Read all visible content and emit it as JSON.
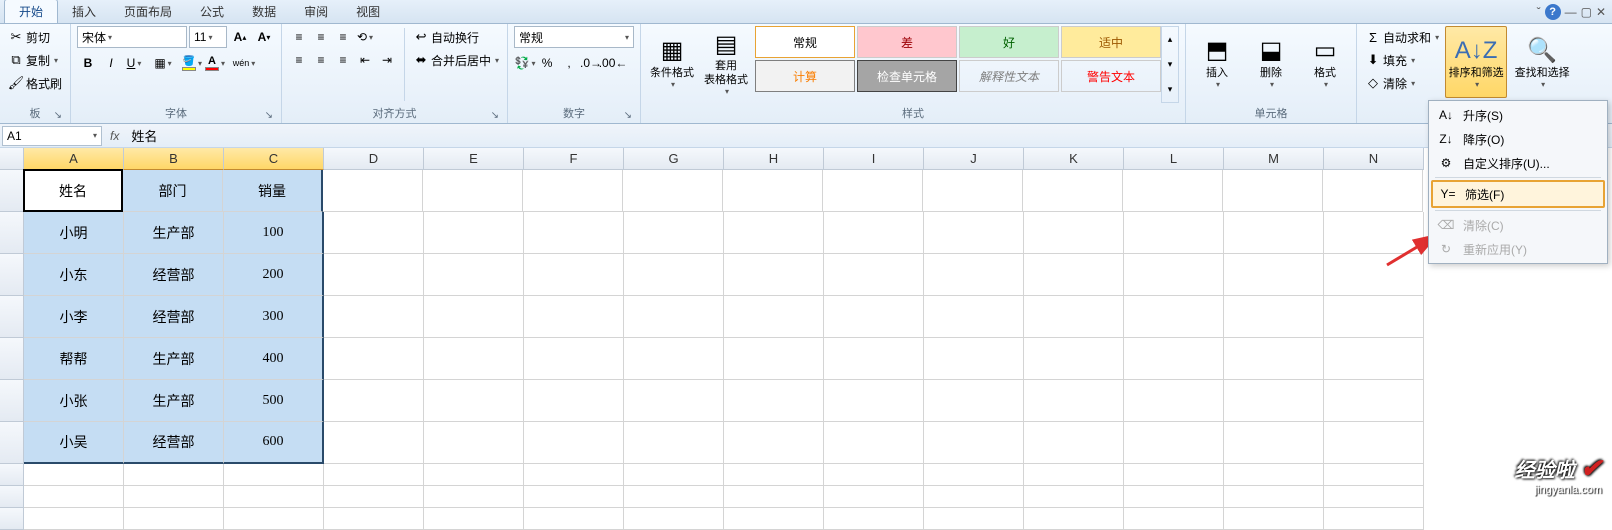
{
  "tabs": {
    "items": [
      "开始",
      "插入",
      "页面布局",
      "公式",
      "数据",
      "审阅",
      "视图"
    ],
    "active": 0
  },
  "clipboard": {
    "cut": "剪切",
    "copy": "复制",
    "painter": "格式刷",
    "group_label": "板"
  },
  "font": {
    "name_value": "宋体",
    "size_value": "11",
    "group_label": "字体"
  },
  "align": {
    "wrap": "自动换行",
    "merge": "合并后居中",
    "group_label": "对齐方式"
  },
  "number": {
    "format_value": "常规",
    "group_label": "数字"
  },
  "styles": {
    "cond": "条件格式",
    "table": "套用\n表格格式",
    "cells": [
      {
        "key": "normal",
        "label": "常规",
        "cls": "style-normal sel"
      },
      {
        "key": "bad",
        "label": "差",
        "cls": "style-bad"
      },
      {
        "key": "good",
        "label": "好",
        "cls": "style-good"
      },
      {
        "key": "neutral",
        "label": "适中",
        "cls": "style-neutral"
      },
      {
        "key": "calc",
        "label": "计算",
        "cls": "style-calc"
      },
      {
        "key": "check",
        "label": "检查单元格",
        "cls": "style-check"
      },
      {
        "key": "explain",
        "label": "解释性文本",
        "cls": "style-explain"
      },
      {
        "key": "warn",
        "label": "警告文本",
        "cls": "style-warn"
      }
    ],
    "group_label": "样式"
  },
  "cells_group": {
    "insert": "插入",
    "delete": "删除",
    "format": "格式",
    "group_label": "单元格"
  },
  "editing": {
    "autosum": "自动求和",
    "fill": "填充",
    "clear": "清除",
    "sort_filter": "排序和筛选",
    "find_select": "查找和选择"
  },
  "namebox": {
    "value": "A1"
  },
  "formula": {
    "fx": "fx",
    "value": "姓名"
  },
  "sheet": {
    "cols_sel": [
      "A",
      "B",
      "C"
    ],
    "cols_rest": [
      "D",
      "E",
      "F",
      "G",
      "H",
      "I",
      "J",
      "K",
      "L",
      "M",
      "N"
    ],
    "data": [
      [
        "姓名",
        "部门",
        "销量"
      ],
      [
        "小明",
        "生产部",
        "100"
      ],
      [
        "小东",
        "经营部",
        "200"
      ],
      [
        "小李",
        "经营部",
        "300"
      ],
      [
        "帮帮",
        "生产部",
        "400"
      ],
      [
        "小张",
        "生产部",
        "500"
      ],
      [
        "小吴",
        "经营部",
        "600"
      ]
    ]
  },
  "dropdown": {
    "sort_asc": "升序(S)",
    "sort_desc": "降序(O)",
    "sort_custom": "自定义排序(U)...",
    "filter": "筛选(F)",
    "clear": "清除(C)",
    "reapply": "重新应用(Y)"
  },
  "watermark": {
    "line1": "经验啦",
    "line2": "jingyanla.com"
  }
}
